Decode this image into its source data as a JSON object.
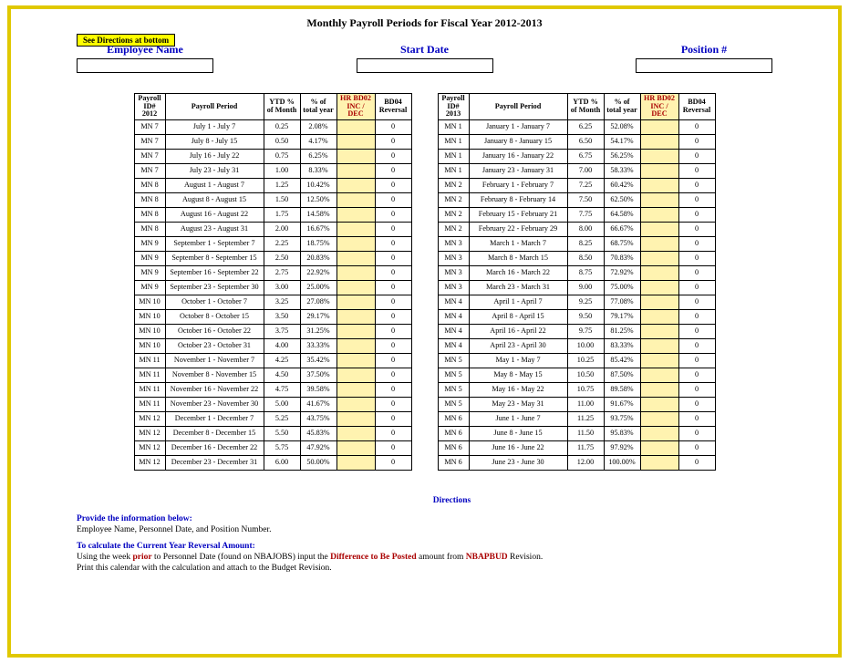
{
  "title": "Monthly Payroll Periods for Fiscal Year 2012-2013",
  "see_directions": "See Directions at bottom",
  "fields": {
    "employee": {
      "label": "Employee Name"
    },
    "startdate": {
      "label": "Start Date"
    },
    "position": {
      "label": "Position #"
    }
  },
  "left": {
    "headers": {
      "id": "Payroll ID# 2012",
      "period": "Payroll Period",
      "ytd": "YTD % of Month",
      "total": "% of total year",
      "hr": "HR BD02 INC / DEC",
      "reversal": "BD04 Reversal"
    },
    "rows": [
      {
        "id": "MN 7",
        "period": "July 1 - July 7",
        "ytd": "0.25",
        "total": "2.08%",
        "rev": "0"
      },
      {
        "id": "MN 7",
        "period": "July 8 - July 15",
        "ytd": "0.50",
        "total": "4.17%",
        "rev": "0"
      },
      {
        "id": "MN 7",
        "period": "July 16 - July 22",
        "ytd": "0.75",
        "total": "6.25%",
        "rev": "0"
      },
      {
        "id": "MN 7",
        "period": "July 23 - July 31",
        "ytd": "1.00",
        "total": "8.33%",
        "rev": "0"
      },
      {
        "id": "MN 8",
        "period": "August 1 - August 7",
        "ytd": "1.25",
        "total": "10.42%",
        "rev": "0"
      },
      {
        "id": "MN 8",
        "period": "August 8 - August 15",
        "ytd": "1.50",
        "total": "12.50%",
        "rev": "0"
      },
      {
        "id": "MN 8",
        "period": "August 16 - August 22",
        "ytd": "1.75",
        "total": "14.58%",
        "rev": "0"
      },
      {
        "id": "MN 8",
        "period": "August 23 - August 31",
        "ytd": "2.00",
        "total": "16.67%",
        "rev": "0"
      },
      {
        "id": "MN 9",
        "period": "September 1 - September 7",
        "ytd": "2.25",
        "total": "18.75%",
        "rev": "0"
      },
      {
        "id": "MN 9",
        "period": "September 8 - September 15",
        "ytd": "2.50",
        "total": "20.83%",
        "rev": "0"
      },
      {
        "id": "MN 9",
        "period": "September 16 - September 22",
        "ytd": "2.75",
        "total": "22.92%",
        "rev": "0"
      },
      {
        "id": "MN 9",
        "period": "September 23 - September 30",
        "ytd": "3.00",
        "total": "25.00%",
        "rev": "0"
      },
      {
        "id": "MN 10",
        "period": "October 1 - October 7",
        "ytd": "3.25",
        "total": "27.08%",
        "rev": "0"
      },
      {
        "id": "MN 10",
        "period": "October 8 - October 15",
        "ytd": "3.50",
        "total": "29.17%",
        "rev": "0"
      },
      {
        "id": "MN 10",
        "period": "October 16 - October 22",
        "ytd": "3.75",
        "total": "31.25%",
        "rev": "0"
      },
      {
        "id": "MN 10",
        "period": "October 23 - October 31",
        "ytd": "4.00",
        "total": "33.33%",
        "rev": "0"
      },
      {
        "id": "MN 11",
        "period": "November 1 - November 7",
        "ytd": "4.25",
        "total": "35.42%",
        "rev": "0"
      },
      {
        "id": "MN 11",
        "period": "November 8 - November 15",
        "ytd": "4.50",
        "total": "37.50%",
        "rev": "0"
      },
      {
        "id": "MN 11",
        "period": "November 16 - November 22",
        "ytd": "4.75",
        "total": "39.58%",
        "rev": "0"
      },
      {
        "id": "MN 11",
        "period": "November 23 - November 30",
        "ytd": "5.00",
        "total": "41.67%",
        "rev": "0"
      },
      {
        "id": "MN 12",
        "period": "December 1 - December 7",
        "ytd": "5.25",
        "total": "43.75%",
        "rev": "0"
      },
      {
        "id": "MN 12",
        "period": "December 8 - December 15",
        "ytd": "5.50",
        "total": "45.83%",
        "rev": "0"
      },
      {
        "id": "MN 12",
        "period": "December 16 - December 22",
        "ytd": "5.75",
        "total": "47.92%",
        "rev": "0"
      },
      {
        "id": "MN 12",
        "period": "December 23 - December 31",
        "ytd": "6.00",
        "total": "50.00%",
        "rev": "0"
      }
    ]
  },
  "right": {
    "headers": {
      "id": "Payroll ID# 2013",
      "period": "Payroll Period",
      "ytd": "YTD % of Month",
      "total": "% of total year",
      "hr": "HR BD02 INC / DEC",
      "reversal": "BD04 Reversal"
    },
    "rows": [
      {
        "id": "MN 1",
        "period": "January 1 - January 7",
        "ytd": "6.25",
        "total": "52.08%",
        "rev": "0"
      },
      {
        "id": "MN 1",
        "period": "January 8 - January 15",
        "ytd": "6.50",
        "total": "54.17%",
        "rev": "0"
      },
      {
        "id": "MN 1",
        "period": "January 16 - January 22",
        "ytd": "6.75",
        "total": "56.25%",
        "rev": "0"
      },
      {
        "id": "MN 1",
        "period": "January 23 - January 31",
        "ytd": "7.00",
        "total": "58.33%",
        "rev": "0"
      },
      {
        "id": "MN 2",
        "period": "February 1 - February 7",
        "ytd": "7.25",
        "total": "60.42%",
        "rev": "0"
      },
      {
        "id": "MN 2",
        "period": "February 8 - February 14",
        "ytd": "7.50",
        "total": "62.50%",
        "rev": "0"
      },
      {
        "id": "MN 2",
        "period": "February 15 - February 21",
        "ytd": "7.75",
        "total": "64.58%",
        "rev": "0"
      },
      {
        "id": "MN 2",
        "period": "February 22 - February 29",
        "ytd": "8.00",
        "total": "66.67%",
        "rev": "0"
      },
      {
        "id": "MN 3",
        "period": "March 1 - March 7",
        "ytd": "8.25",
        "total": "68.75%",
        "rev": "0"
      },
      {
        "id": "MN 3",
        "period": "March 8 - March 15",
        "ytd": "8.50",
        "total": "70.83%",
        "rev": "0"
      },
      {
        "id": "MN 3",
        "period": "March 16 - March 22",
        "ytd": "8.75",
        "total": "72.92%",
        "rev": "0"
      },
      {
        "id": "MN 3",
        "period": "March 23 - March 31",
        "ytd": "9.00",
        "total": "75.00%",
        "rev": "0"
      },
      {
        "id": "MN 4",
        "period": "April 1 - April 7",
        "ytd": "9.25",
        "total": "77.08%",
        "rev": "0"
      },
      {
        "id": "MN 4",
        "period": "April 8 - April 15",
        "ytd": "9.50",
        "total": "79.17%",
        "rev": "0"
      },
      {
        "id": "MN 4",
        "period": "April 16 - April 22",
        "ytd": "9.75",
        "total": "81.25%",
        "rev": "0"
      },
      {
        "id": "MN 4",
        "period": "April 23 - April 30",
        "ytd": "10.00",
        "total": "83.33%",
        "rev": "0"
      },
      {
        "id": "MN 5",
        "period": "May 1 - May 7",
        "ytd": "10.25",
        "total": "85.42%",
        "rev": "0"
      },
      {
        "id": "MN 5",
        "period": "May 8 - May 15",
        "ytd": "10.50",
        "total": "87.50%",
        "rev": "0"
      },
      {
        "id": "MN 5",
        "period": "May 16 - May 22",
        "ytd": "10.75",
        "total": "89.58%",
        "rev": "0"
      },
      {
        "id": "MN 5",
        "period": "May 23 - May 31",
        "ytd": "11.00",
        "total": "91.67%",
        "rev": "0"
      },
      {
        "id": "MN 6",
        "period": "June 1 - June 7",
        "ytd": "11.25",
        "total": "93.75%",
        "rev": "0"
      },
      {
        "id": "MN 6",
        "period": "June 8 - June 15",
        "ytd": "11.50",
        "total": "95.83%",
        "rev": "0"
      },
      {
        "id": "MN 6",
        "period": "June 16 - June 22",
        "ytd": "11.75",
        "total": "97.92%",
        "rev": "0"
      },
      {
        "id": "MN 6",
        "period": "June 23 - June 30",
        "ytd": "12.00",
        "total": "100.00%",
        "rev": "0"
      }
    ]
  },
  "directions": {
    "title": "Directions",
    "h1": "Provide the information below:",
    "l1": "Employee Name, Personnel Date, and Position Number.",
    "h2": "To calculate the Current Year Reversal Amount:",
    "l2a": "Using the week ",
    "l2b": "prior",
    "l2c": " to Personnel Date (found on NBAJOBS) input the ",
    "l2d": "Difference to Be Posted",
    "l2e": " amount from ",
    "l2f": "NBAPBUD",
    "l2g": " Revision.",
    "l3": "Print this calendar with the calculation and attach to the Budget Revision."
  }
}
